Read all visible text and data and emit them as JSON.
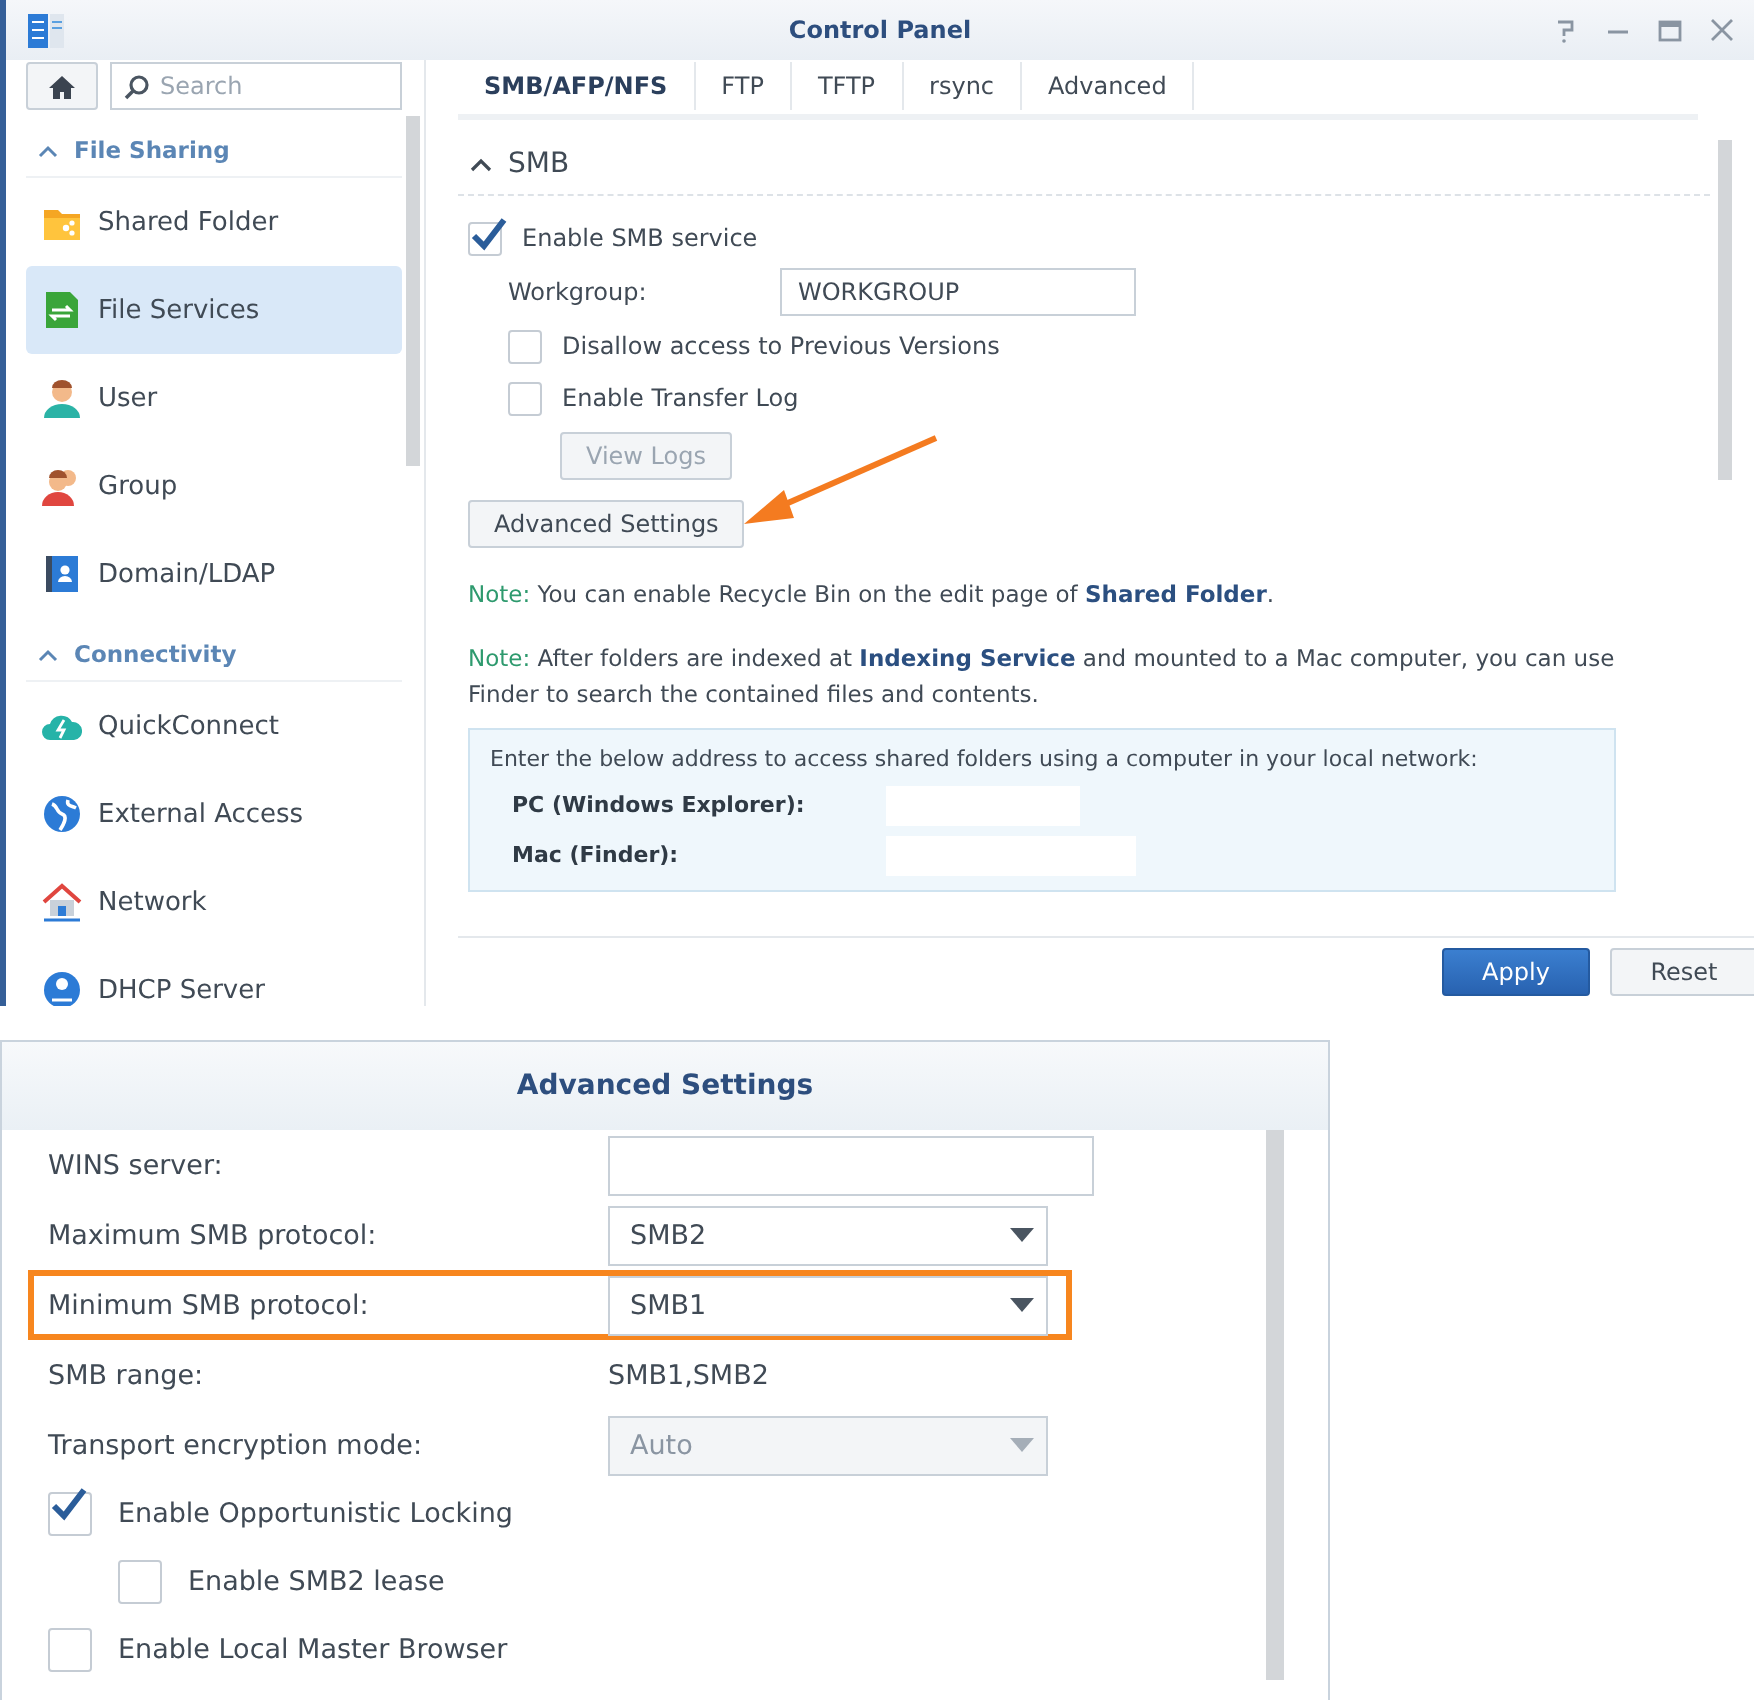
{
  "window": {
    "title": "Control Panel"
  },
  "sidebar": {
    "search": {
      "placeholder": "Search"
    },
    "groups": [
      {
        "label": "File Sharing",
        "expanded": true,
        "items": [
          {
            "kind": "shared-folder",
            "label": "Shared Folder",
            "selected": false
          },
          {
            "kind": "file-services",
            "label": "File Services",
            "selected": true
          },
          {
            "kind": "user",
            "label": "User",
            "selected": false
          },
          {
            "kind": "group",
            "label": "Group",
            "selected": false
          },
          {
            "kind": "domain",
            "label": "Domain/LDAP",
            "selected": false
          }
        ]
      },
      {
        "label": "Connectivity",
        "expanded": true,
        "items": [
          {
            "kind": "quickconnect",
            "label": "QuickConnect",
            "selected": false
          },
          {
            "kind": "external-access",
            "label": "External Access",
            "selected": false
          },
          {
            "kind": "network",
            "label": "Network",
            "selected": false
          },
          {
            "kind": "dhcp",
            "label": "DHCP Server",
            "selected": false
          }
        ]
      }
    ]
  },
  "tabs": [
    {
      "label": "SMB/AFP/NFS",
      "selected": true
    },
    {
      "label": "FTP",
      "selected": false
    },
    {
      "label": "TFTP",
      "selected": false
    },
    {
      "label": "rsync",
      "selected": false
    },
    {
      "label": "Advanced",
      "selected": false
    }
  ],
  "smb": {
    "title": "SMB",
    "expanded": true,
    "enable": {
      "label": "Enable SMB service",
      "checked": true
    },
    "workgroup": {
      "label": "Workgroup:",
      "value": "WORKGROUP"
    },
    "options": [
      {
        "label": "Disallow access to Previous Versions",
        "checked": false
      },
      {
        "label": "Enable Transfer Log",
        "checked": false
      }
    ],
    "view_logs": "View Logs",
    "advanced_button": "Advanced Settings",
    "notes": [
      {
        "label": "Note:",
        "text": "You can enable Recycle Bin on the edit page of **Shared Folder**."
      },
      {
        "label": "Note:",
        "text": "After folders are indexed at **Indexing Service** and mounted to a Mac computer, you can use Finder to search the contained files and contents."
      }
    ],
    "address_box": {
      "intro": "Enter the below address to access shared folders using a computer in your local network:",
      "rows": [
        {
          "label": "PC (Windows Explorer):"
        },
        {
          "label": "Mac (Finder):"
        }
      ]
    }
  },
  "footer_buttons": [
    {
      "kind": "primary",
      "label": "Apply"
    },
    {
      "kind": "secondary",
      "label": "Reset"
    }
  ],
  "advanced": {
    "title": "Advanced Settings",
    "fields": [
      {
        "kind": "text",
        "label": "WINS server:",
        "highlighted": false
      },
      {
        "kind": "select",
        "label": "Maximum SMB protocol:",
        "value": "SMB2",
        "disabled": false,
        "highlighted": false
      },
      {
        "kind": "select",
        "label": "Minimum SMB protocol:",
        "value": "SMB1",
        "disabled": false,
        "highlighted": true
      },
      {
        "kind": "static",
        "label": "SMB range:",
        "value": "SMB1,SMB2",
        "highlighted": false
      },
      {
        "kind": "select",
        "label": "Transport encryption mode:",
        "value": "Auto",
        "disabled": true,
        "highlighted": false
      },
      {
        "kind": "checkbox",
        "label": "Enable Opportunistic Locking",
        "checked": true,
        "children": [
          {
            "kind": "checkbox",
            "label": "Enable SMB2 lease",
            "checked": false
          }
        ]
      },
      {
        "kind": "checkbox",
        "label": "Enable Local Master Browser",
        "checked": false
      }
    ]
  }
}
